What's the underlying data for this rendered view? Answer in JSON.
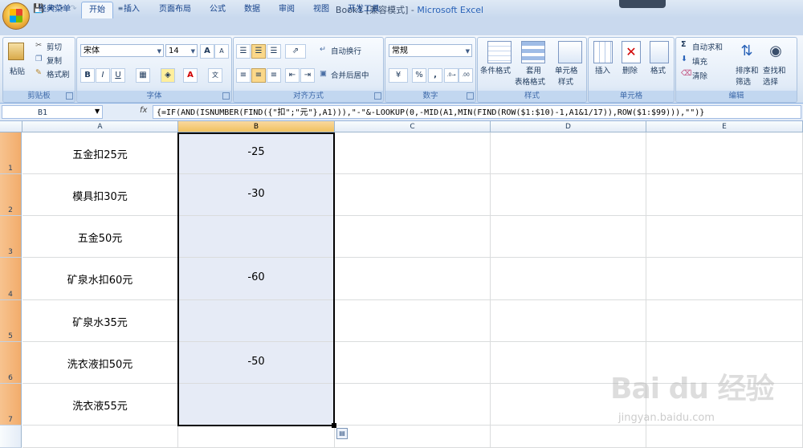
{
  "title": {
    "doc": "Book1",
    "mode": "[兼容模式]",
    "sep": "-",
    "app": "Microsoft Excel"
  },
  "tabs": [
    "经典菜单",
    "开始",
    "插入",
    "页面布局",
    "公式",
    "数据",
    "审阅",
    "视图",
    "开发工具"
  ],
  "active_tab": "开始",
  "clipboard": {
    "paste": "粘贴",
    "cut": "剪切",
    "copy": "复制",
    "format_painter": "格式刷",
    "label": "剪贴板"
  },
  "font": {
    "name": "宋体",
    "size": "14",
    "bold": "B",
    "italic": "I",
    "underline": "U",
    "grow": "A",
    "shrink": "A",
    "label": "字体"
  },
  "alignment": {
    "wrap_text": "自动换行",
    "merge_center": "合并后居中",
    "label": "对齐方式"
  },
  "number": {
    "format": "常规",
    "percent": "%",
    "comma": ",",
    "inc_decimal": ".0→.00",
    "dec_decimal": ".00→.0",
    "label": "数字"
  },
  "styles": {
    "conditional": "条件格式",
    "table_format_1": "套用",
    "table_format_2": "表格格式",
    "cell_style_1": "单元格",
    "cell_style_2": "样式",
    "label": "样式"
  },
  "cells": {
    "insert": "插入",
    "delete": "删除",
    "format": "格式",
    "label": "单元格"
  },
  "editing": {
    "autosum": "自动求和",
    "fill": "填充",
    "clear": "清除",
    "sort_1": "排序和",
    "sort_2": "筛选",
    "find_1": "查找和",
    "find_2": "选择",
    "label": "编辑"
  },
  "formula_bar": {
    "name_box": "B1",
    "fx": "fx",
    "formula": "{=IF(AND(ISNUMBER(FIND({\"扣\";\"元\"},A1))),\"-\"&-LOOKUP(0,-MID(A1,MIN(FIND(ROW($1:$10)-1,A1&1/17)),ROW($1:$99))),\"\")}"
  },
  "sheet": {
    "columns": [
      "A",
      "B",
      "C",
      "D",
      "E"
    ],
    "selected_column": "B",
    "rows": [
      {
        "num": "1",
        "a": "五金扣25元",
        "b": "-25"
      },
      {
        "num": "2",
        "a": "模具扣30元",
        "b": "-30"
      },
      {
        "num": "3",
        "a": "五金50元",
        "b": ""
      },
      {
        "num": "4",
        "a": "矿泉水扣60元",
        "b": "-60"
      },
      {
        "num": "5",
        "a": "矿泉水35元",
        "b": ""
      },
      {
        "num": "6",
        "a": "洗衣液扣50元",
        "b": "-50"
      },
      {
        "num": "7",
        "a": "洗衣液55元",
        "b": ""
      }
    ]
  },
  "watermark": {
    "logo": "Bai du 经验",
    "url": "jingyan.baidu.com"
  },
  "colors": {
    "selection_header": "#f1c15f",
    "selection_fill": "#e6ebf6",
    "ribbon": "#dfe9f5",
    "app_title": "#2a63b8"
  }
}
